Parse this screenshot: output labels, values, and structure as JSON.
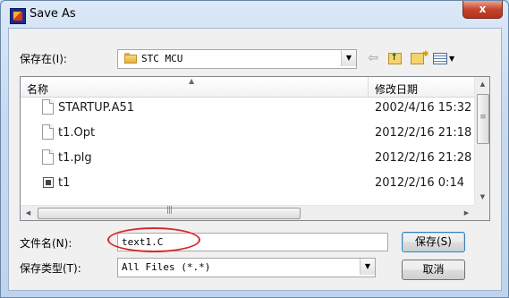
{
  "window": {
    "title": "Save As",
    "close_label": "x"
  },
  "lookin": {
    "label": "保存在(I):",
    "value": "STC MCU"
  },
  "toolbar": {
    "back_icon": "back-arrow-icon",
    "up_icon": "up-folder-icon",
    "new_folder_icon": "new-folder-icon",
    "view_icon": "view-menu-icon"
  },
  "file_list": {
    "columns": [
      "名称",
      "修改日期"
    ],
    "rows": [
      {
        "name": "STARTUP.A51",
        "date": "2002/4/16 15:32",
        "icon": "file-icon"
      },
      {
        "name": "t1.Opt",
        "date": "2012/2/16 21:18",
        "icon": "file-icon"
      },
      {
        "name": "t1.plg",
        "date": "2012/2/16 21:28",
        "icon": "file-icon"
      },
      {
        "name": "t1",
        "date": "2012/2/16 0:14",
        "icon": "project-icon"
      }
    ]
  },
  "filename": {
    "label": "文件名(N):",
    "value": "text1.C"
  },
  "filetype": {
    "label": "保存类型(T):",
    "value": "All Files (*.*)"
  },
  "buttons": {
    "save": "保存(S)",
    "cancel": "取消"
  },
  "colors": {
    "annotation_circle": "#d82a2a",
    "close_button": "#c4452c"
  }
}
